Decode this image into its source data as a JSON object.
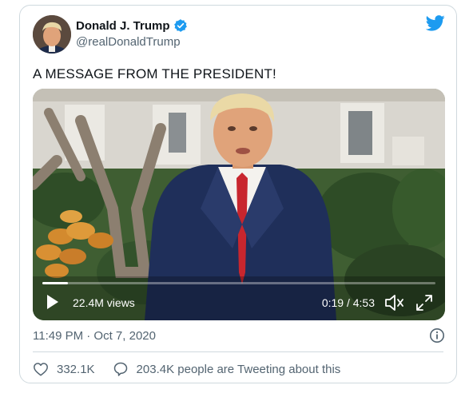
{
  "author": {
    "display_name": "Donald J. Trump",
    "handle": "@realDonaldTrump",
    "verified": true
  },
  "tweet": {
    "text": "A MESSAGE FROM THE PRESIDENT!",
    "timestamp": "11:49 PM · Oct 7, 2020"
  },
  "video": {
    "views": "22.4M views",
    "time": "0:19 / 4:53",
    "progress": 0.065
  },
  "actions": {
    "likes": "332.1K",
    "tweeting": "203.4K people are Tweeting about this"
  },
  "colors": {
    "accent": "#1d9bf0",
    "secondary_text": "#536471",
    "border": "#cfd9de"
  },
  "icons": [
    "twitter-bird-icon",
    "verified-badge-icon",
    "play-icon",
    "volume-icon",
    "fullscreen-icon",
    "info-icon",
    "heart-icon",
    "speech-bubble-icon"
  ]
}
